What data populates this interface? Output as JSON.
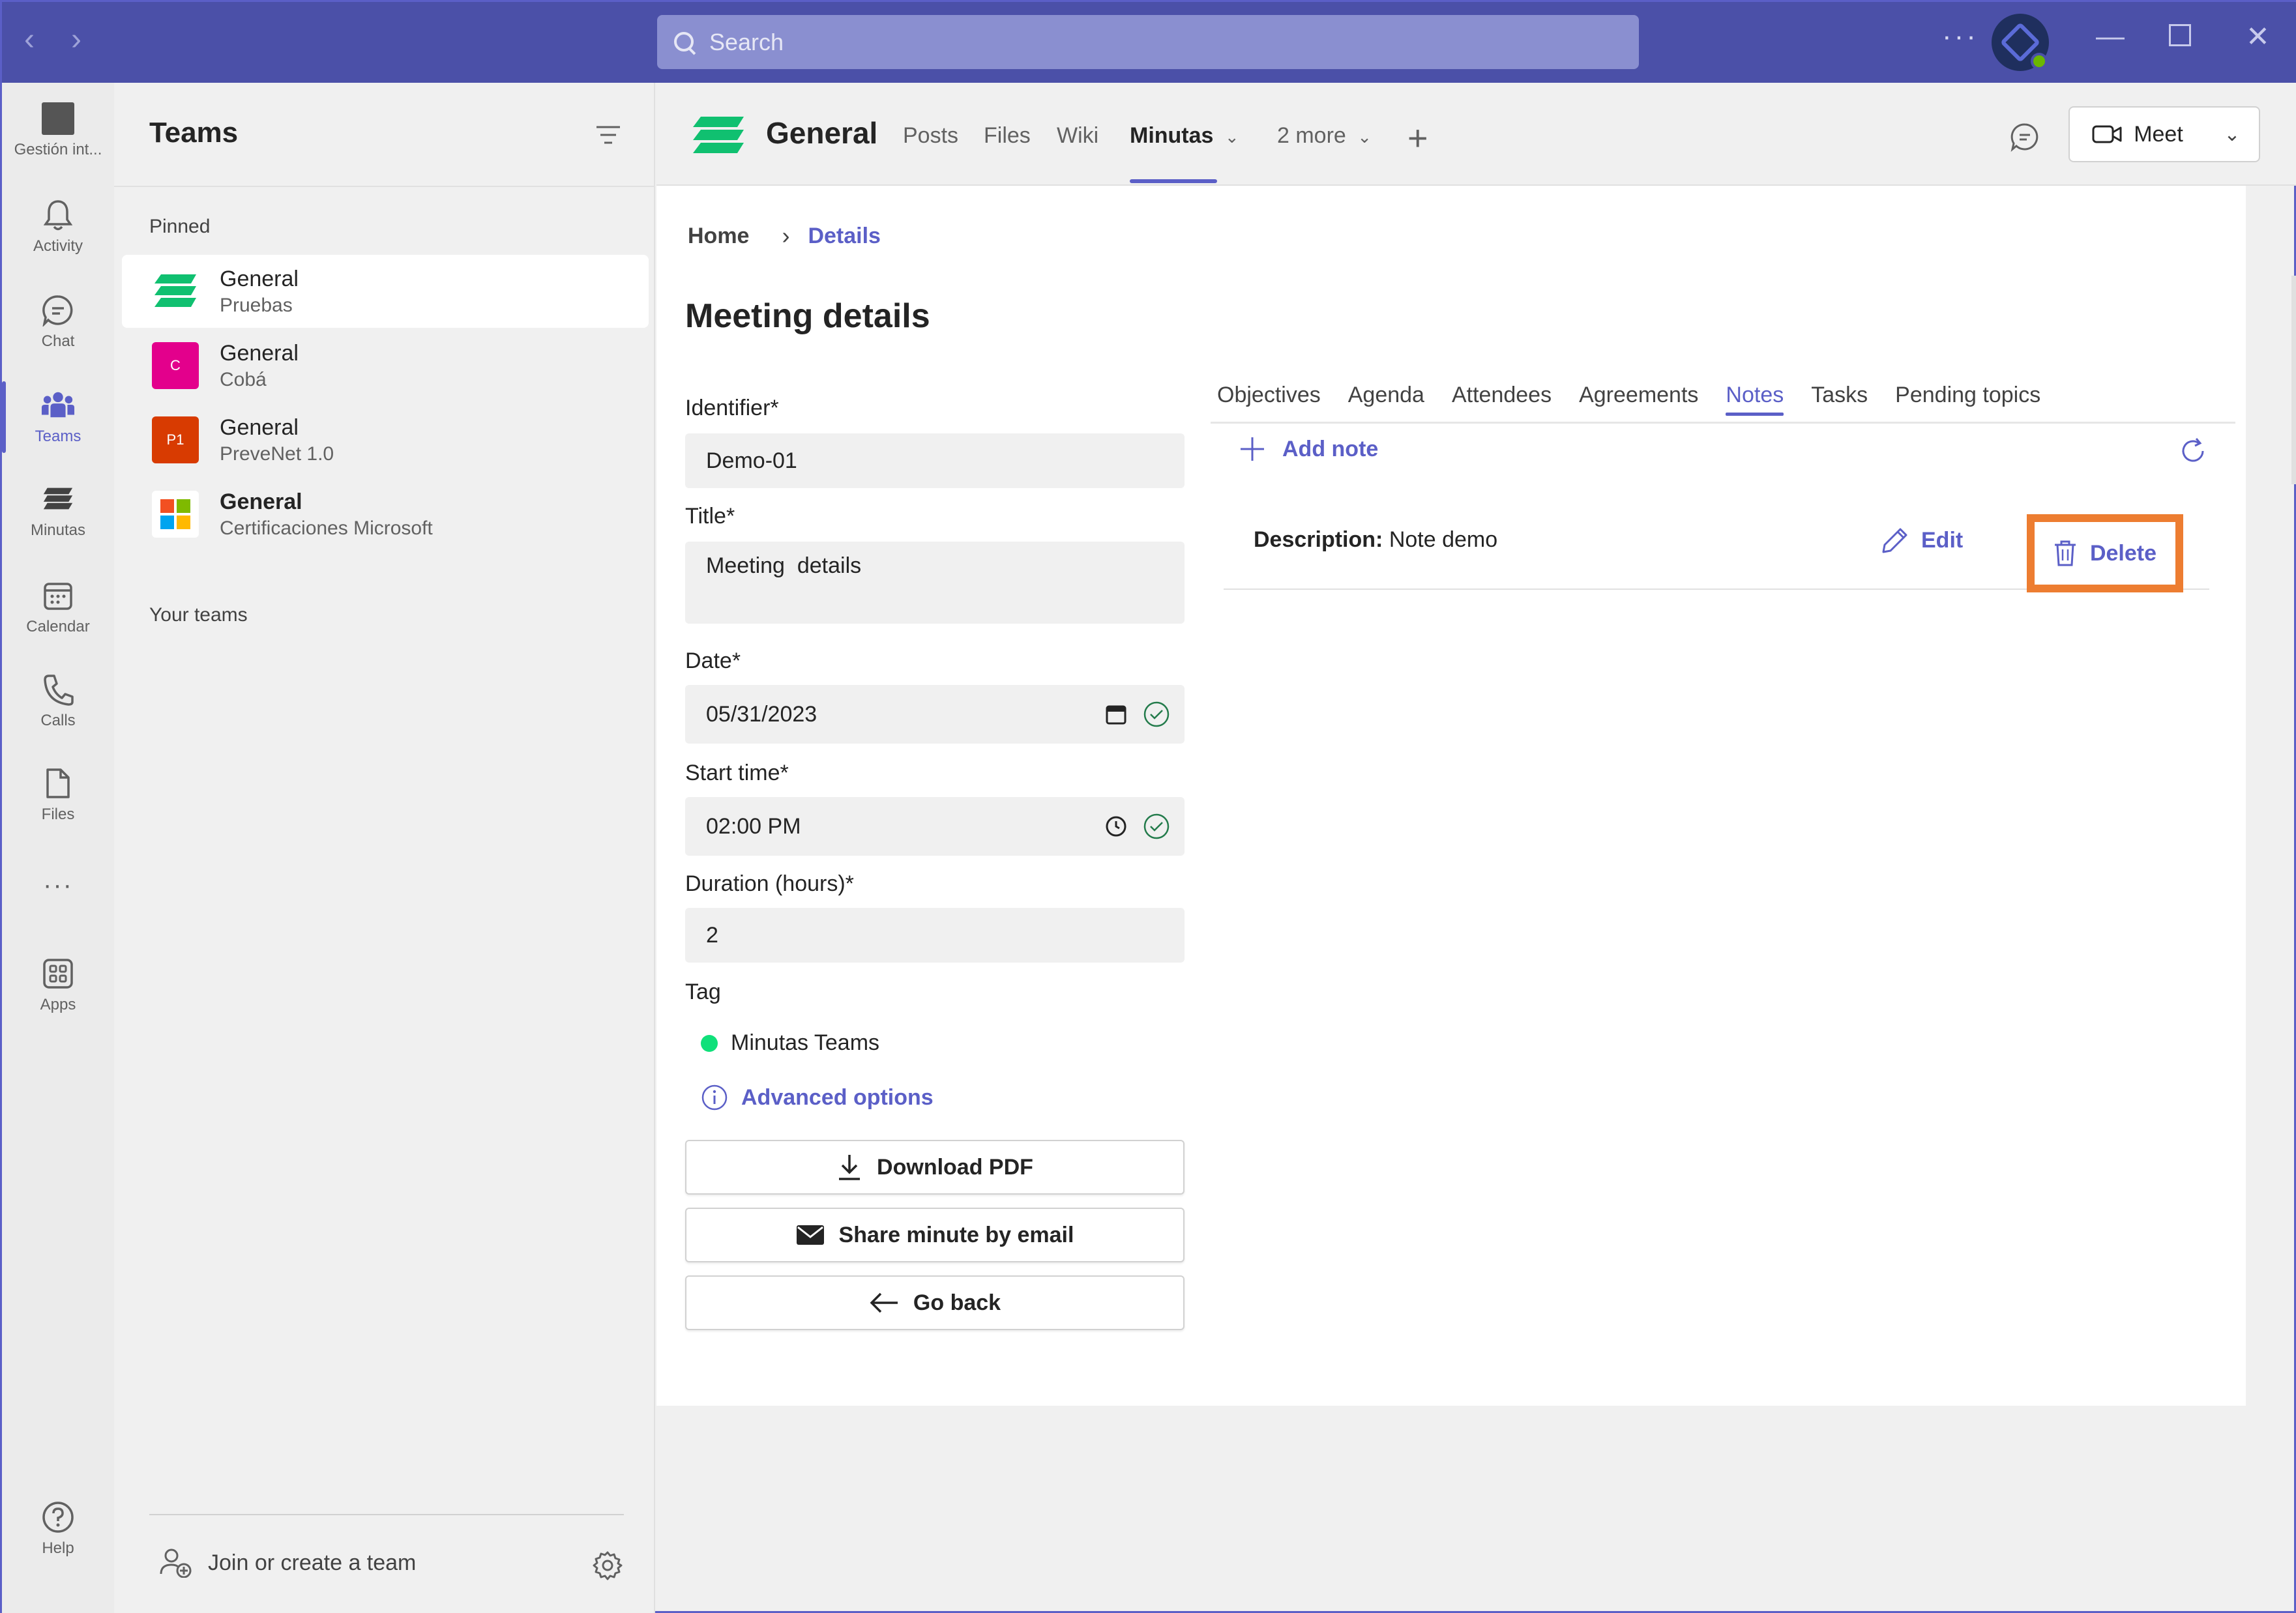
{
  "titlebar": {
    "search_placeholder": "Search",
    "more": "···",
    "colors": {
      "bar": "#4b50a8",
      "search": "#8a8fd0"
    }
  },
  "rail": {
    "items": [
      {
        "label": "Gestión int...",
        "icon": "team-square-icon"
      },
      {
        "label": "Activity",
        "icon": "bell-icon"
      },
      {
        "label": "Chat",
        "icon": "chat-bubble-icon"
      },
      {
        "label": "Teams",
        "icon": "people-icon",
        "active": true
      },
      {
        "label": "Minutas",
        "icon": "minutas-app-icon"
      },
      {
        "label": "Calendar",
        "icon": "calendar-icon"
      },
      {
        "label": "Calls",
        "icon": "phone-icon"
      },
      {
        "label": "Files",
        "icon": "file-icon"
      },
      {
        "label": "···",
        "icon": "more-icon"
      },
      {
        "label": "Apps",
        "icon": "apps-grid-icon"
      },
      {
        "label": "Help",
        "icon": "help-icon"
      }
    ]
  },
  "teams_pane": {
    "title": "Teams",
    "pinned_label": "Pinned",
    "your_teams_label": "Your teams",
    "pinned": [
      {
        "name": "General",
        "team": "Pruebas",
        "selected": true,
        "icon_color": "#10c070"
      },
      {
        "name": "General",
        "team": "Cobá",
        "icon_letter": "C",
        "icon_color": "#e3008c"
      },
      {
        "name": "General",
        "team": "PreveNet 1.0",
        "icon_letter": "P1",
        "icon_color": "#d83b01"
      },
      {
        "name": "General",
        "team": "Certificaciones Microsoft",
        "bold": true
      }
    ],
    "join_label": "Join or create a team"
  },
  "channel_header": {
    "channel_name": "General",
    "tabs": [
      "Posts",
      "Files",
      "Wiki",
      "Minutas",
      "2 more"
    ],
    "active_tab": "Minutas",
    "meet_label": "Meet"
  },
  "breadcrumb": {
    "home": "Home",
    "current": "Details"
  },
  "page_title": "Meeting details",
  "form": {
    "identifier_label": "Identifier*",
    "identifier_value": "Demo-01",
    "title_label": "Title*",
    "title_value": "Meeting  details",
    "date_label": "Date*",
    "date_value": "05/31/2023",
    "start_time_label": "Start time*",
    "start_time_value": "02:00 PM",
    "duration_label": "Duration (hours)*",
    "duration_value": "2",
    "tag_label": "Tag",
    "tag_value": "Minutas Teams",
    "tag_color": "#10e07a",
    "advanced_options": "Advanced options"
  },
  "actions": {
    "download_pdf": "Download PDF",
    "share_email": "Share minute by email",
    "go_back": "Go back"
  },
  "detail_tabs": {
    "items": [
      "Objectives",
      "Agenda",
      "Attendees",
      "Agreements",
      "Notes",
      "Tasks",
      "Pending topics"
    ],
    "active": "Notes"
  },
  "notes": {
    "add_note_label": "Add note",
    "items": [
      {
        "description_label": "Description:",
        "description_value": "Note demo",
        "edit_label": "Edit",
        "delete_label": "Delete"
      }
    ],
    "highlight_color": "#ed7d31"
  },
  "colors": {
    "accent": "#5b5fc7"
  }
}
